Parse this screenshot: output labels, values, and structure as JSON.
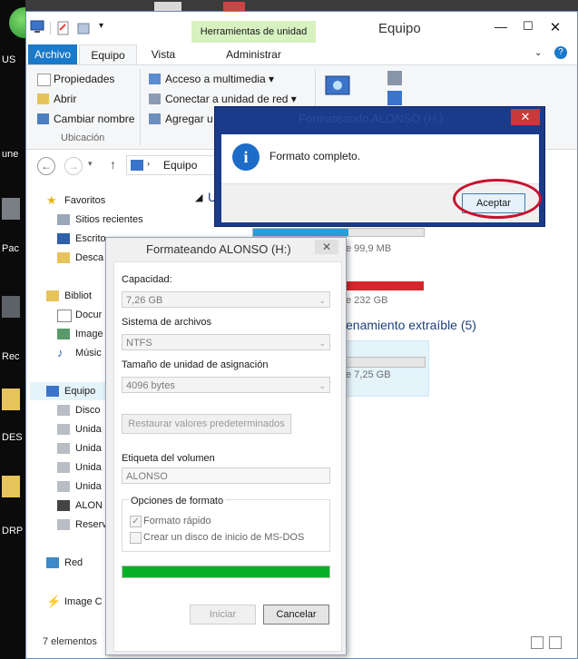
{
  "desktop": {
    "labels": [
      "US",
      "une",
      "Pac",
      "Rec",
      "DES",
      "DRP"
    ]
  },
  "explorer": {
    "title": "Equipo",
    "contextual_group": "Herramientas de unidad",
    "tabs": {
      "archivo": "Archivo",
      "equipo": "Equipo",
      "vista": "Vista",
      "administrar": "Administrar"
    },
    "ribbon": {
      "propiedades": "Propiedades",
      "abrir": "Abrir",
      "cambiar_nombre": "Cambiar nombre",
      "group_ubicacion": "Ubicación",
      "acceso_multimedia": "Acceso a multimedia",
      "conectar_unidad": "Conectar a unidad de red",
      "agregar_ubicacion": "Agregar u"
    },
    "breadcrumb": "Equipo",
    "tree": {
      "favoritos": "Favoritos",
      "sitios_recientes": "Sitios recientes",
      "escritorio": "Escrito",
      "descargas": "Desca",
      "bibliotecas": "Bibliot",
      "documentos": "Docur",
      "imagenes": "Image",
      "musica": "Músic",
      "equipo": "Equipo",
      "disco": "Disco",
      "unidad1": "Unida",
      "unidad2": "Unida",
      "unidad3": "Unida",
      "unidad4": "Unida",
      "alonso": "ALON",
      "reserv": "Reserv",
      "red": "Red",
      "image_c": "Image C"
    },
    "content": {
      "drive1_free": "e 99,9 MB",
      "drive2_free": "e 232 GB",
      "section_removable": "enamiento extraíble (5)",
      "drive3_free": "e 7,25 GB"
    },
    "status": "7 elementos",
    "colors": {
      "accent": "#1979ca",
      "ribbon_context": "#d7f1c0",
      "drive_full": "#d9262c",
      "drive_normal": "#26a0da"
    }
  },
  "format_dialog": {
    "title": "Formateando ALONSO (H:)",
    "capacidad_label": "Capacidad:",
    "capacidad_value": "7,26 GB",
    "sistema_label": "Sistema de archivos",
    "sistema_value": "NTFS",
    "tamano_label": "Tamaño de unidad de asignación",
    "tamano_value": "4096 bytes",
    "restaurar": "Restaurar valores predeterminados",
    "etiqueta_label": "Etiqueta del volumen",
    "etiqueta_value": "ALONSO",
    "opciones_label": "Opciones de formato",
    "formato_rapido": "Formato rápido",
    "ms_dos": "Crear un disco de inicio de MS-DOS",
    "progress": 1.0,
    "iniciar": "Iniciar",
    "cancelar": "Cancelar",
    "colors": {
      "progress": "#06b025"
    }
  },
  "message_box": {
    "title": "Formateando ALONSO (H:)",
    "text": "Formato completo.",
    "ok": "Aceptar",
    "colors": {
      "highlight": "#c8102e"
    }
  }
}
